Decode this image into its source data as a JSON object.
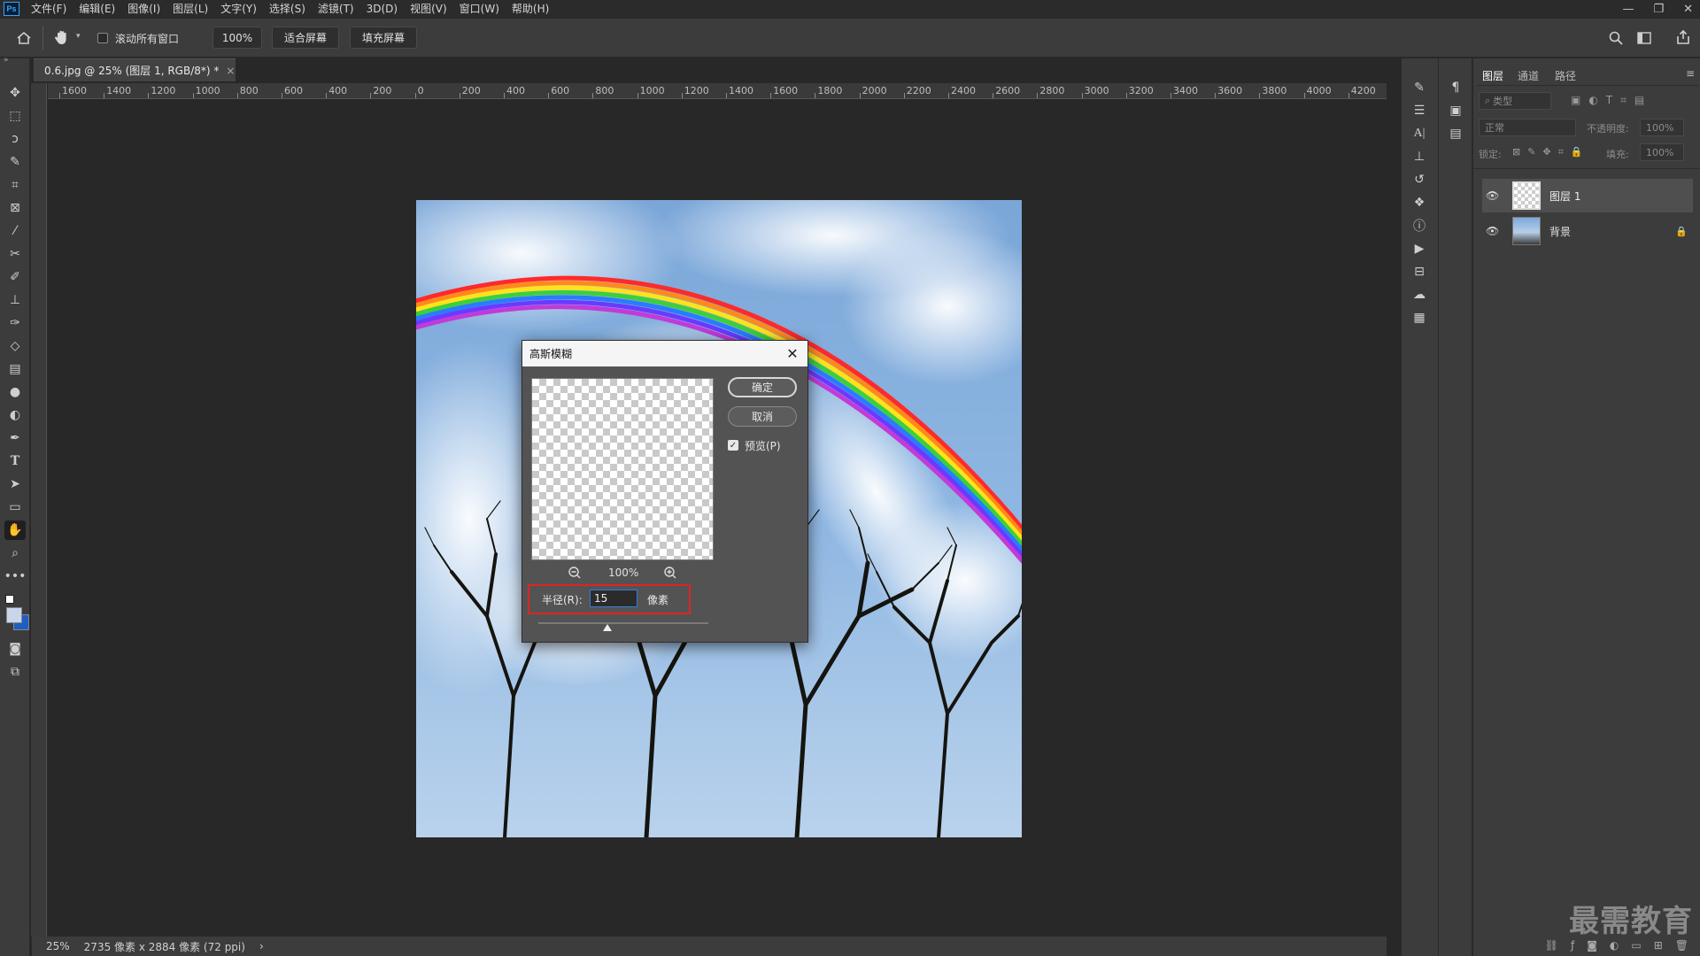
{
  "app": {
    "logo": "Ps"
  },
  "menu": [
    "文件(F)",
    "编辑(E)",
    "图像(I)",
    "图层(L)",
    "文字(Y)",
    "选择(S)",
    "滤镜(T)",
    "3D(D)",
    "视图(V)",
    "窗口(W)",
    "帮助(H)"
  ],
  "window_controls": {
    "minimize": "—",
    "restore": "❐",
    "close": "✕"
  },
  "options": {
    "scroll_all_label": "滚动所有窗口",
    "zoom": "100%",
    "fit_screen": "适合屏幕",
    "fill_screen": "填充屏幕"
  },
  "document": {
    "tab_title": "0.6.jpg @ 25% (图层 1, RGB/8*) *",
    "tab_close": "×"
  },
  "ruler": {
    "h_labels": [
      "1600",
      "1400",
      "1200",
      "1000",
      "800",
      "600",
      "400",
      "200",
      "0",
      "200",
      "400",
      "600",
      "800",
      "1000",
      "1200",
      "1400",
      "1600",
      "1800",
      "2000",
      "2200",
      "2400",
      "2600",
      "2800",
      "3000",
      "3200",
      "3400",
      "3600",
      "3800",
      "4000",
      "4200"
    ]
  },
  "status": {
    "zoom": "25%",
    "info": "2735 像素 x 2884 像素 (72 ppi)",
    "arrow": "›"
  },
  "layers_panel": {
    "tabs": [
      "图层",
      "通道",
      "路径"
    ],
    "search_placeholder": "类型",
    "blend_mode": "正常",
    "opacity_label": "不透明度:",
    "opacity_value": "100%",
    "lock_label": "锁定:",
    "fill_label": "填充:",
    "fill_value": "100%",
    "layers": [
      {
        "name": "图层 1",
        "selected": true
      },
      {
        "name": "背景",
        "selected": false,
        "locked": true
      }
    ]
  },
  "dialog": {
    "title": "高斯模糊",
    "ok": "确定",
    "cancel": "取消",
    "preview_label": "预览(P)",
    "preview_checked": true,
    "preview_zoom": "100%",
    "radius_label": "半径(R):",
    "radius_value": "15",
    "radius_unit": "像素"
  },
  "watermark": "最需教育",
  "colors": {
    "accent_red": "#e02424",
    "focus_blue": "#2f7fe0",
    "panel_bg": "#3c3c3c",
    "canvas_bg": "#282828"
  }
}
